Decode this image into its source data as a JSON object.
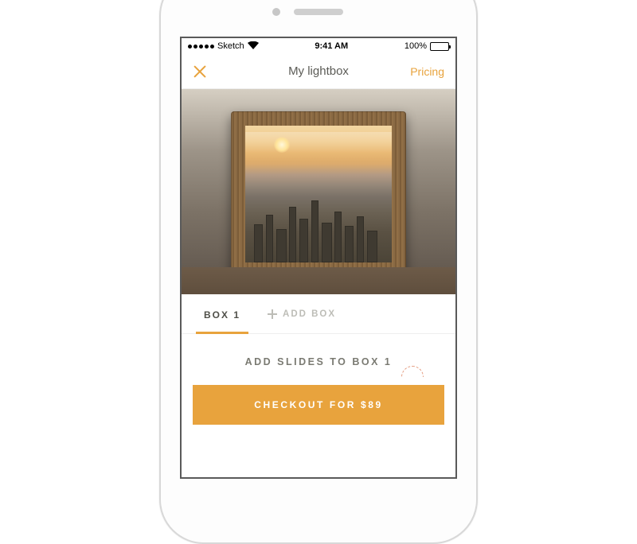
{
  "status": {
    "carrier": "Sketch",
    "time": "9:41 AM",
    "battery_pct": "100%"
  },
  "nav": {
    "title": "My lightbox",
    "right_link": "Pricing"
  },
  "tabs": {
    "active": "BOX 1",
    "add_box": "ADD BOX"
  },
  "instruction": "ADD SLIDES TO BOX 1",
  "cta": "CHECKOUT FOR $89",
  "colors": {
    "accent": "#e8a33d"
  }
}
